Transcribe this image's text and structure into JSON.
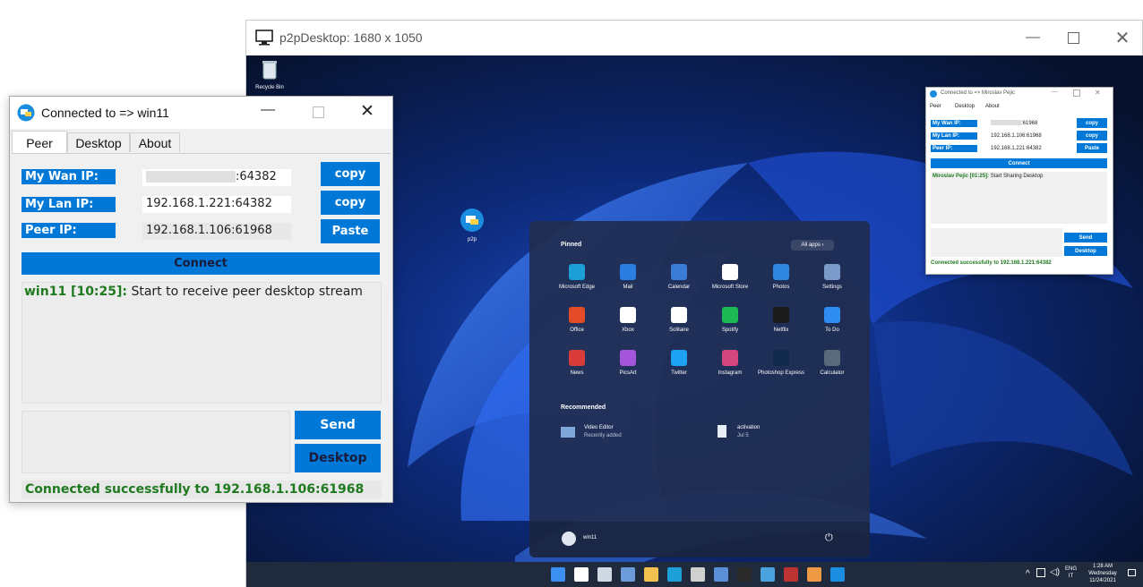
{
  "remote_window": {
    "title": "p2pDesktop: 1680 x 1050",
    "recycle_bin_label": "Recycle Bin",
    "p2p_icon_label": "p2p"
  },
  "remote_peer_window": {
    "title": "Connected to => Miroslav Pejic",
    "tabs": [
      "Peer",
      "Desktop",
      "About"
    ],
    "wan_label": "My Wan IP:",
    "wan_value": ":61968",
    "lan_label": "My Lan IP:",
    "lan_value": "192.168.1.106:61968",
    "peer_label": "Peer IP:",
    "peer_value": "192.168.1.221:64382",
    "copy_label": "copy",
    "paste_label": "Paste",
    "connect_label": "Connect",
    "log_name": "Miroslav Pejic [01:25]:",
    "log_text": " Start Sharing Desktop",
    "send_label": "Send",
    "desktop_label": "Desktop",
    "status": "Connected successfully to 192.168.1.221:64382"
  },
  "start_menu": {
    "pinned_label": "Pinned",
    "all_apps_label": "All apps",
    "apps": [
      {
        "name": "Microsoft Edge",
        "color": "#1da0d8"
      },
      {
        "name": "Mail",
        "color": "#2a7de1"
      },
      {
        "name": "Calendar",
        "color": "#3a7bd5"
      },
      {
        "name": "Microsoft Store",
        "color": "#ffffff"
      },
      {
        "name": "Photos",
        "color": "#2f87e0"
      },
      {
        "name": "Settings",
        "color": "#7a9bc9"
      },
      {
        "name": "Office",
        "color": "#e34b26"
      },
      {
        "name": "Xbox",
        "color": "#ffffff"
      },
      {
        "name": "Solitaire",
        "color": "#ffffff"
      },
      {
        "name": "Spotify",
        "color": "#1db954"
      },
      {
        "name": "Netflix",
        "color": "#1a1a1a"
      },
      {
        "name": "To Do",
        "color": "#2f8cf0"
      },
      {
        "name": "News",
        "color": "#d93b3b"
      },
      {
        "name": "PicsArt",
        "color": "#a455d9"
      },
      {
        "name": "Twitter",
        "color": "#1da1f2"
      },
      {
        "name": "Instagram",
        "color": "#d3477e"
      },
      {
        "name": "Photoshop Express",
        "color": "#0f2a4a"
      },
      {
        "name": "Calculator",
        "color": "#5a6a7a"
      }
    ],
    "recommended_label": "Recommended",
    "recommended": [
      {
        "name": "Video Editor",
        "sub": "Recently added"
      },
      {
        "name": "activation",
        "sub": "Jul 5"
      }
    ],
    "user_name": "win11"
  },
  "taskbar": {
    "lang": "ENG",
    "lang_sub": "IT",
    "time": "1:28 AM",
    "day": "Wednesday",
    "date": "11/24/2021"
  },
  "local_window": {
    "title": "Connected to => win11",
    "tabs": [
      "Peer",
      "Desktop",
      "About"
    ],
    "wan_label": "My Wan IP:",
    "wan_value": ":64382",
    "lan_label": "My Lan IP:",
    "lan_value": "192.168.1.221:64382",
    "peer_label": "Peer IP:",
    "peer_value": "192.168.1.106:61968",
    "copy_label": "copy",
    "paste_label": "Paste",
    "connect_label": "Connect",
    "log_name": "win11 [10:25]:",
    "log_text": " Start to receive peer desktop stream",
    "send_label": "Send",
    "desktop_label": "Desktop",
    "status": "Connected successfully to 192.168.1.106:61968"
  },
  "colors": {
    "accent": "#0078d7",
    "status_green": "#1f7a1f",
    "desktop_bg": "#0a1a40"
  }
}
